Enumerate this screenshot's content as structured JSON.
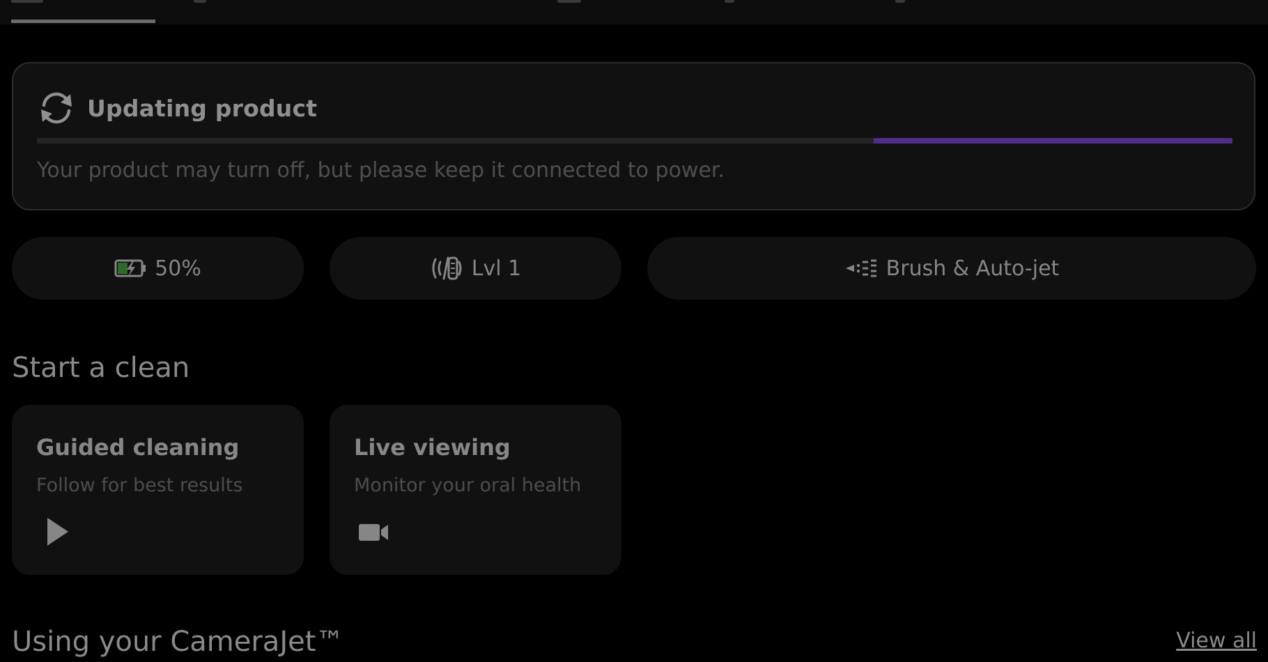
{
  "update": {
    "title": "Updating product",
    "note": "Your product may turn off, but please keep it connected to power.",
    "progress": 0.3
  },
  "status_chips": [
    {
      "icon": "battery-charging-icon",
      "label": "50%"
    },
    {
      "icon": "intensity-level-icon",
      "label": "Lvl 1"
    },
    {
      "icon": "spray-mode-icon",
      "label": "Brush & Auto-jet"
    }
  ],
  "start_clean": {
    "heading": "Start a clean",
    "cards": [
      {
        "title": "Guided cleaning",
        "subtitle": "Follow for best results",
        "icon": "play-icon"
      },
      {
        "title": "Live viewing",
        "subtitle": "Monitor your oral health",
        "icon": "video-camera-icon"
      }
    ]
  },
  "using": {
    "heading": "Using your CameraJet™",
    "view_all": "View all"
  },
  "colors": {
    "background": "#000000",
    "card": "#111111",
    "progress_accent": "#4f2e86",
    "battery_accent": "#2e6b2a"
  }
}
